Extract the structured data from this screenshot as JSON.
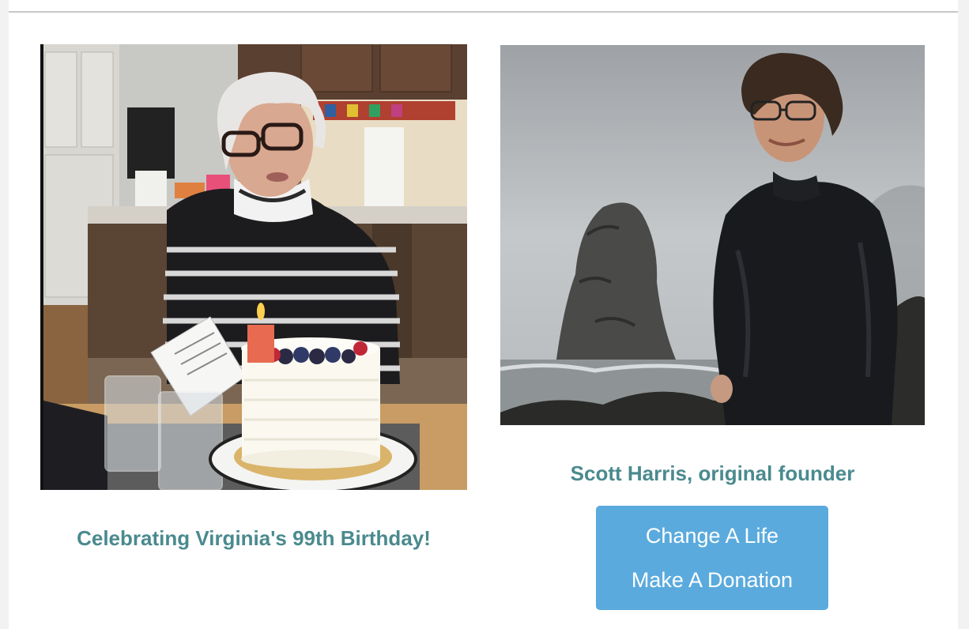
{
  "left_photo": {
    "caption": "Celebrating Virginia's 99th Birthday!"
  },
  "right_photo": {
    "caption": "Scott Harris, original founder"
  },
  "donate_button": {
    "line1": "Change A Life",
    "line2": "Make A Donation"
  },
  "colors": {
    "caption_teal": "#4a8a8e",
    "button_blue": "#5aaadd",
    "divider": "#c8c8c8"
  }
}
